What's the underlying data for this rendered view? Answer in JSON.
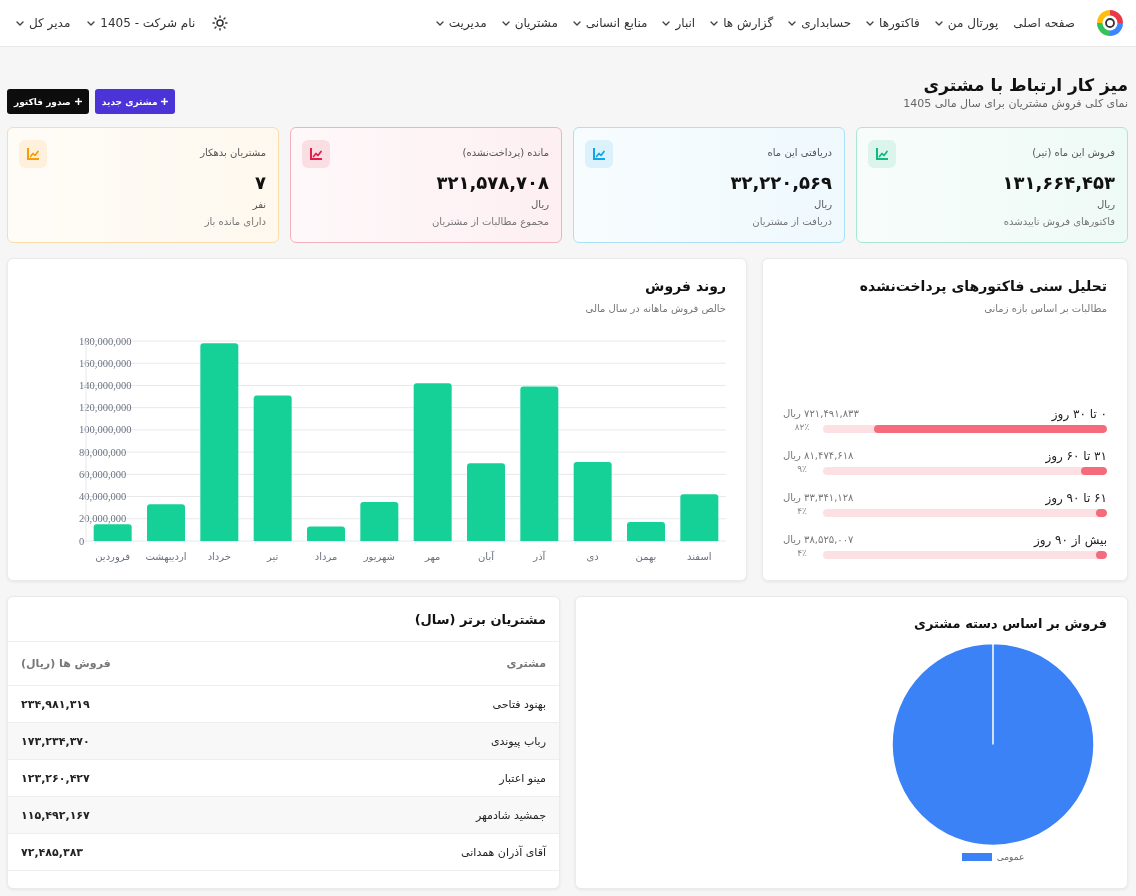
{
  "nav": {
    "items": [
      {
        "label": "صفحه اصلی",
        "has_menu": false
      },
      {
        "label": "پورتال من",
        "has_menu": true
      },
      {
        "label": "فاکتورها",
        "has_menu": true
      },
      {
        "label": "حسابداری",
        "has_menu": true
      },
      {
        "label": "گزارش ها",
        "has_menu": true
      },
      {
        "label": "انبار",
        "has_menu": true
      },
      {
        "label": "منابع انسانی",
        "has_menu": true
      },
      {
        "label": "مشتریان",
        "has_menu": true
      },
      {
        "label": "مدیریت",
        "has_menu": true
      }
    ],
    "user_menus": [
      {
        "label": "نام شرکت - 1405",
        "has_menu": true
      },
      {
        "label": "مدیر کل",
        "has_menu": true
      }
    ]
  },
  "header": {
    "title": "میز کار ارتباط با مشتری",
    "subtitle": "نمای کلی فروش مشتریان برای سال مالی 1405",
    "buttons": [
      {
        "label": "مشتری جدید",
        "kind": "primary"
      },
      {
        "label": "صدور فاکتور",
        "kind": "dark"
      }
    ]
  },
  "kpis": [
    {
      "label": "فروش این ماه (تیر)",
      "value": "۱۳۱,۶۶۴,۴۵۳",
      "unit": "ریال",
      "note": "فاکتورهای فروش تاییدشده",
      "color": "#10b981"
    },
    {
      "label": "دریافتی این ماه",
      "value": "۳۲,۲۲۰,۵۶۹",
      "unit": "ریال",
      "note": "دریافت از مشتریان",
      "color": "#0ea5e9"
    },
    {
      "label": "مانده (پرداخت‌نشده)",
      "value": "۳۲۱,۵۷۸,۷۰۸",
      "unit": "ریال",
      "note": "مجموع مطالبات از مشتریان",
      "color": "#e11d48"
    },
    {
      "label": "مشتریان بدهکار",
      "value": "۷",
      "unit": "نفر",
      "note": "دارای مانده باز",
      "color": "#f59e0b"
    }
  ],
  "aging": {
    "title": "تحلیل سنی فاکتورهای پرداخت‌نشده",
    "subtitle": "مطالبات بر اساس بازه زمانی",
    "buckets": [
      {
        "label": "۰ تا ۳۰ روز",
        "amount": "۷۲۱,۴۹۱,۸۳۳ ریال",
        "percent": "۸۲٪",
        "level": 0.82
      },
      {
        "label": "۳۱ تا ۶۰ روز",
        "amount": "۸۱,۴۷۴,۶۱۸ ریال",
        "percent": "۹٪",
        "level": 0.09
      },
      {
        "label": "۶۱ تا ۹۰ روز",
        "amount": "۳۳,۳۴۱,۱۲۸ ریال",
        "percent": "۴٪",
        "level": 0.04
      },
      {
        "label": "بیش از ۹۰ روز",
        "amount": "۳۸,۵۲۵,۰۰۷ ریال",
        "percent": "۴٪",
        "level": 0.04
      }
    ]
  },
  "sales_trend": {
    "title": "روند فروش",
    "subtitle": "خالص فروش ماهانه در سال مالی",
    "chart_data": {
      "type": "bar",
      "grid": true,
      "categories": [
        "فروردین",
        "اردیبهشت",
        "خرداد",
        "تیر",
        "مرداد",
        "شهریور",
        "مهر",
        "آبان",
        "آذر",
        "دی",
        "بهمن",
        "اسفند"
      ],
      "values": [
        15000000,
        33000000,
        178000000,
        131000000,
        13000000,
        35000000,
        142000000,
        70000000,
        139000000,
        71000000,
        17000000,
        42000000
      ],
      "ylim": [
        0,
        180000000
      ],
      "yticks": [
        {
          "value": 0,
          "label": "0"
        },
        {
          "value": 20000000,
          "label": "20,000,000"
        },
        {
          "value": 40000000,
          "label": "40,000,000"
        },
        {
          "value": 60000000,
          "label": "60,000,000"
        },
        {
          "value": 80000000,
          "label": "80,000,000"
        },
        {
          "value": 100000000,
          "label": "100,000,000"
        },
        {
          "value": 120000000,
          "label": "120,000,000"
        },
        {
          "value": 140000000,
          "label": "140,000,000"
        },
        {
          "value": 160000000,
          "label": "160,000,000"
        },
        {
          "value": 180000000,
          "label": "180,000,000"
        }
      ]
    }
  },
  "category_sales": {
    "title": "فروش بر اساس دسته مشتری",
    "legend": [
      {
        "label": "عمومی"
      }
    ]
  },
  "top_customers": {
    "title": "مشتریان برتر (سال)",
    "columns": [
      "مشتری",
      "فروش ها (ریال)"
    ],
    "rows": [
      {
        "customer": "بهنود فتاحی",
        "sales": "۲۳۴,۹۸۱,۳۱۹"
      },
      {
        "customer": "رباب پیوندی",
        "sales": "۱۷۳,۲۳۴,۳۷۰"
      },
      {
        "customer": "مینو اعتبار",
        "sales": "۱۲۳,۲۶۰,۴۲۷"
      },
      {
        "customer": "جمشید شادمهر",
        "sales": "۱۱۵,۴۹۲,۱۶۷"
      },
      {
        "customer": "آقای آذران همدانی",
        "sales": "۷۲,۴۸۵,۳۸۳"
      }
    ]
  }
}
